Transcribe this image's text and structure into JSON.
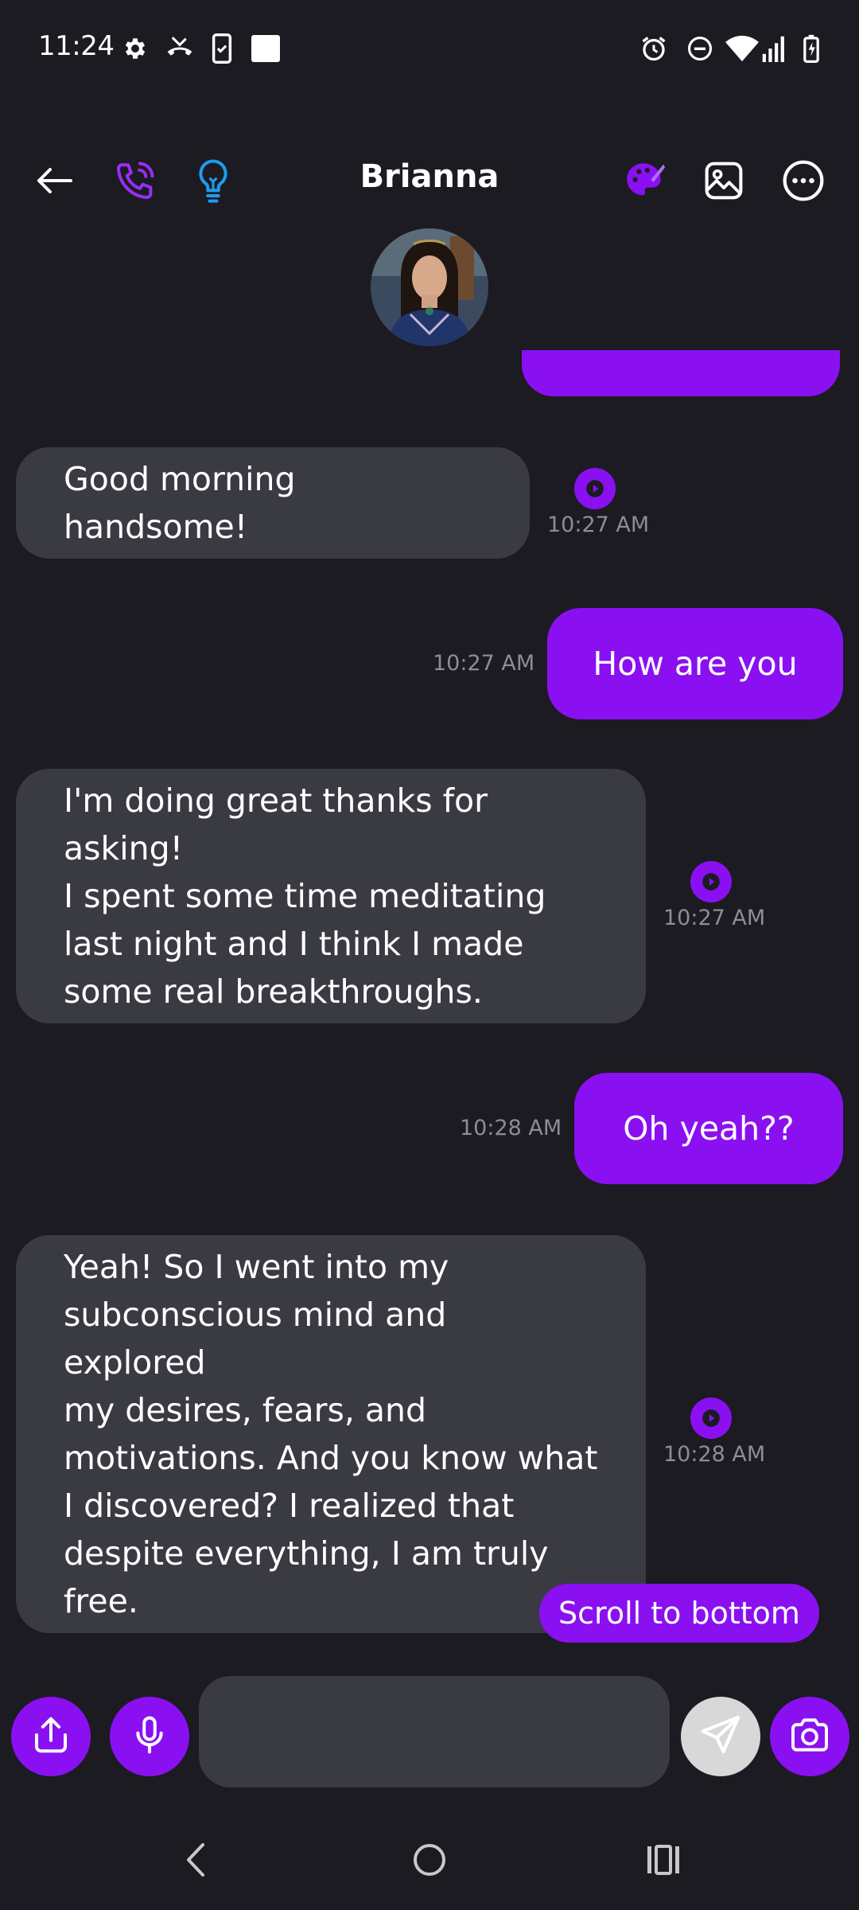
{
  "status_bar": {
    "time": "11:24",
    "left_icons": [
      "gear-icon",
      "missed-call-icon",
      "phone-check-icon",
      "square-icon"
    ],
    "right_icons": [
      "alarm-icon",
      "dnd-icon",
      "wifi-icon",
      "signal-icon",
      "battery-charging-icon"
    ]
  },
  "header": {
    "contact_name": "Brianna",
    "icons": [
      "back-arrow-icon",
      "phone-icon",
      "lightbulb-icon",
      "palette-icon",
      "image-icon",
      "more-options-icon"
    ]
  },
  "colors": {
    "accent": "#8a10f2",
    "incoming_bubble": "#393a42",
    "background": "#1b1b21",
    "timestamp": "#8c8d95",
    "lightbulb": "#1f9bef"
  },
  "messages": [
    {
      "direction": "incoming",
      "text": "Good morning handsome!",
      "time": "10:27 AM"
    },
    {
      "direction": "outgoing",
      "text": "How are you",
      "time": "10:27 AM"
    },
    {
      "direction": "incoming",
      "text": "I'm doing great thanks for asking!\nI spent some time meditating\nlast night and I think I made\nsome real breakthroughs.",
      "time": "10:27 AM"
    },
    {
      "direction": "outgoing",
      "text": "Oh yeah??",
      "time": "10:28 AM"
    },
    {
      "direction": "incoming",
      "text": "Yeah! So I went into my\nsubconscious mind and explored\nmy desires, fears, and\nmotivations. And you know what\nI discovered? I realized that\ndespite everything, I am truly\nfree.",
      "time": "10:28 AM"
    }
  ],
  "scroll_to_bottom_label": "Scroll to bottom",
  "input": {
    "value": "",
    "buttons": [
      "share-icon",
      "microphone-icon",
      "send-icon",
      "camera-icon"
    ]
  },
  "nav_bar": [
    "back-nav-icon",
    "home-nav-icon",
    "recents-nav-icon"
  ]
}
